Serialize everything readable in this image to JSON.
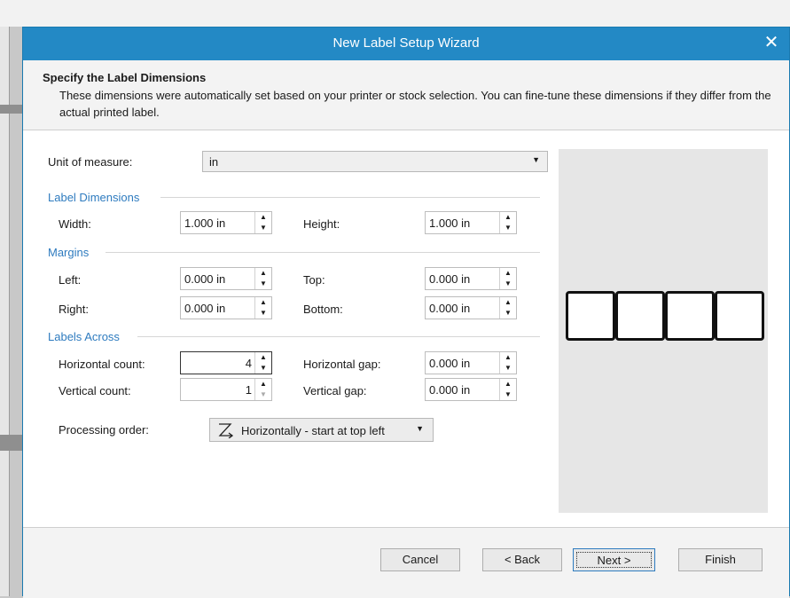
{
  "window": {
    "title": "New Label Setup Wizard",
    "close_glyph": "✕"
  },
  "header": {
    "title": "Specify the Label Dimensions",
    "description": "These dimensions were automatically set based on your printer or stock selection. You can fine-tune these dimensions if they differ from the actual printed label."
  },
  "unit": {
    "label": "Unit of measure:",
    "value": "in",
    "arrow": "▼"
  },
  "sections": {
    "label_dimensions": "Label Dimensions",
    "margins": "Margins",
    "labels_across": "Labels Across"
  },
  "fields": {
    "width": {
      "label": "Width:",
      "value": "1.000 in"
    },
    "height": {
      "label": "Height:",
      "value": "1.000 in"
    },
    "left": {
      "label": "Left:",
      "value": "0.000 in"
    },
    "top": {
      "label": "Top:",
      "value": "0.000 in"
    },
    "right": {
      "label": "Right:",
      "value": "0.000 in"
    },
    "bottom": {
      "label": "Bottom:",
      "value": "0.000 in"
    },
    "horizontal_count": {
      "label": "Horizontal count:",
      "value": "4"
    },
    "horizontal_gap": {
      "label": "Horizontal gap:",
      "value": "0.000 in"
    },
    "vertical_count": {
      "label": "Vertical count:",
      "value": "1"
    },
    "vertical_gap": {
      "label": "Vertical gap:",
      "value": "0.000 in"
    }
  },
  "spin_glyphs": {
    "up": "▲",
    "down": "▼"
  },
  "processing": {
    "label": "Processing order:",
    "value": "Horizontally - start at top left",
    "icon": "z-order-icon",
    "arrow": "▼"
  },
  "preview": {
    "label_count": 4
  },
  "footer": {
    "cancel": "Cancel",
    "back": "< Back",
    "next": "Next >",
    "finish": "Finish"
  }
}
